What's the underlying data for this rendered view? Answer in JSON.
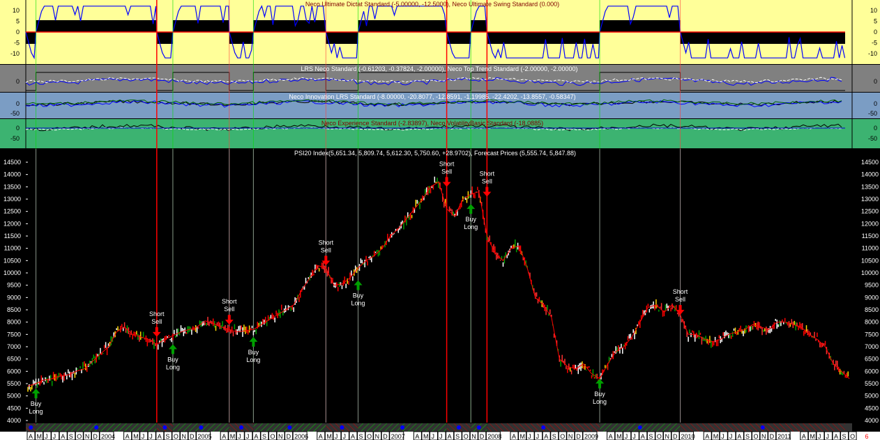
{
  "panels": {
    "dictat": {
      "title": "Neco Ultimate Dictat Standard (-5.00000, -12.5000), Neco Ultimate Swing Standard (0.000)",
      "ticks": [
        "10",
        "5",
        "0",
        "-5",
        "-10"
      ],
      "tick_values": [
        10,
        5,
        0,
        -5,
        -10
      ],
      "bg": "#FFFF99"
    },
    "lrs": {
      "title": "LRS Neco Standard (-0.61203, -0.37824, -2.00000), Neco Top Trend Standard (-2.00000, -2.00000)",
      "ticks": [
        "0"
      ],
      "bg": "#808080"
    },
    "innovation": {
      "title": "Neco Innovation LRS Standard (-8.00000, -20.8077, -12.8591, -1.19985, -22.4202, -13.8557, -0.58347)",
      "ticks": [
        "0",
        "-50"
      ],
      "bg": "#7B9DC4"
    },
    "experience": {
      "title": "Neco Experience Standard (-2.83897), Neco VolatilityBasic Standard (-18.0885)",
      "ticks": [
        "0",
        "-50"
      ],
      "bg": "#3CB371"
    }
  },
  "corner_label": "6",
  "colors": {
    "short": "#FF0000",
    "long": "#00C000",
    "price_up": "#FFFFFF",
    "price_down": "#FF0000"
  },
  "chart_data": {
    "type": "line",
    "title": "PSI20 Index(5,651.34, 5,809.74, 5,612.30, 5,750.60, +28.9702), Forecast Prices (5,555.74, 5,847.88)",
    "xlabel": "",
    "ylabel": "",
    "ylim": [
      4000,
      14500
    ],
    "y_ticks": [
      14500,
      14000,
      13500,
      13000,
      12500,
      12000,
      11500,
      11000,
      10500,
      10000,
      9500,
      9000,
      8500,
      8000,
      7500,
      7000,
      6500,
      6000,
      5500,
      5000,
      4500,
      4000
    ],
    "x_labels": [
      "A",
      "M",
      "J",
      "J",
      "A",
      "S",
      "O",
      "N",
      "D",
      "2004",
      "",
      "",
      "A",
      "M",
      "J",
      "J",
      "A",
      "S",
      "O",
      "N",
      "D",
      "2005",
      "",
      "",
      "A",
      "M",
      "J",
      "J",
      "A",
      "S",
      "O",
      "N",
      "D",
      "2006",
      "",
      "",
      "A",
      "M",
      "J",
      "J",
      "A",
      "S",
      "O",
      "N",
      "D",
      "2007",
      "",
      "",
      "A",
      "M",
      "J",
      "J",
      "A",
      "S",
      "O",
      "N",
      "D",
      "2008",
      "",
      "",
      "A",
      "M",
      "J",
      "J",
      "A",
      "S",
      "O",
      "N",
      "D",
      "2009",
      "",
      "",
      "A",
      "M",
      "J",
      "J",
      "A",
      "S",
      "O",
      "N",
      "D",
      "2010",
      "",
      "",
      "A",
      "M",
      "J",
      "J",
      "A",
      "S",
      "O",
      "N",
      "D",
      "2011",
      "",
      "",
      "A",
      "M",
      "J",
      "J",
      "A",
      "S",
      "O"
    ],
    "start": "2003-04",
    "series": [
      {
        "name": "PSI20 Index (monthly approx.)",
        "values": [
          5400,
          5500,
          5650,
          5700,
          5800,
          5850,
          6000,
          6100,
          6400,
          6700,
          7000,
          7600,
          7800,
          7500,
          7400,
          7300,
          7100,
          7300,
          7450,
          7600,
          7700,
          7800,
          8050,
          7950,
          7800,
          7700,
          7600,
          7650,
          7700,
          7900,
          8100,
          8300,
          8500,
          8700,
          9300,
          9800,
          10300,
          10200,
          9500,
          9550,
          9800,
          10200,
          10500,
          10700,
          11000,
          11500,
          11800,
          12200,
          12600,
          13000,
          13500,
          13700,
          12600,
          12300,
          13000,
          13200,
          13300,
          11500,
          10800,
          10500,
          11000,
          11100,
          10200,
          9000,
          8700,
          8200,
          6500,
          6200,
          6100,
          6300,
          5900,
          5700,
          6300,
          6800,
          7000,
          7400,
          8000,
          8600,
          8700,
          8400,
          8700,
          8300,
          7500,
          7500,
          7300,
          7200,
          7300,
          7500,
          7600,
          7700,
          7900,
          7800,
          7700,
          8000,
          8000,
          7900,
          7800,
          7500,
          7300,
          7000,
          6300,
          6000,
          5700
        ]
      }
    ],
    "signals": [
      {
        "type": "buy",
        "label1": "Buy",
        "label2": "Long",
        "date": "2003-05",
        "price": 5300
      },
      {
        "type": "short",
        "label1": "Short",
        "label2": "Sell",
        "date": "2004-08",
        "price": 7400
      },
      {
        "type": "buy",
        "label1": "Buy",
        "label2": "Long",
        "date": "2004-10",
        "price": 7100
      },
      {
        "type": "short",
        "label1": "Short",
        "label2": "Sell",
        "date": "2005-05",
        "price": 7900
      },
      {
        "type": "buy",
        "label1": "Buy",
        "label2": "Long",
        "date": "2005-08",
        "price": 7400
      },
      {
        "type": "short",
        "label1": "Short",
        "label2": "Sell",
        "date": "2006-05",
        "price": 10300
      },
      {
        "type": "buy",
        "label1": "Buy",
        "label2": "Long",
        "date": "2006-09",
        "price": 9700
      },
      {
        "type": "short",
        "label1": "Short",
        "label2": "Sell",
        "date": "2007-08",
        "price": 13500
      },
      {
        "type": "buy",
        "label1": "Buy",
        "label2": "Long",
        "date": "2007-11",
        "price": 12800
      },
      {
        "type": "short",
        "label1": "Short",
        "label2": "Sell",
        "date": "2008-01",
        "price": 13100
      },
      {
        "type": "buy",
        "label1": "Buy",
        "label2": "Long",
        "date": "2009-03",
        "price": 5700
      },
      {
        "type": "short",
        "label1": "Short",
        "label2": "Sell",
        "date": "2010-01",
        "price": 8300
      }
    ]
  }
}
